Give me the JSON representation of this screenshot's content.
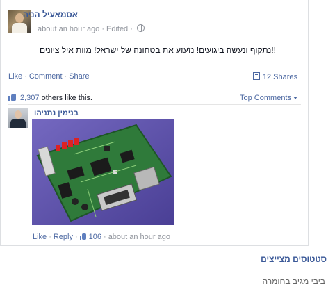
{
  "post": {
    "author": "אסמאעיל הניה",
    "time": "about an hour ago",
    "edited": "Edited",
    "text": "!!נתקוף ונעשה ביגועים! נזעזע את בטחונה של ישראל! מוות איל ציונים",
    "actions": {
      "like": "Like",
      "comment": "Comment",
      "share": "Share"
    },
    "shares": "12 Shares",
    "likes_count": "2,307",
    "likes_text": "others like this.",
    "top_comments": "Top Comments"
  },
  "comment": {
    "author": "בנימין נתניהו",
    "actions": {
      "like": "Like",
      "reply": "Reply",
      "likes": "106",
      "time": "about an hour ago"
    }
  },
  "sidebar": {
    "title": "סטטוסים מצייצים",
    "item": "ביבי מגיב בחומרה"
  },
  "icons": [
    "globe-icon",
    "share-icon",
    "thumbs-up-icon",
    "caret-down-icon"
  ],
  "colors": {
    "link": "#3b5998",
    "action": "#4b67a1",
    "muted": "#90949c",
    "pcb": "#2f7a3a",
    "background": "#5a4fa8"
  }
}
